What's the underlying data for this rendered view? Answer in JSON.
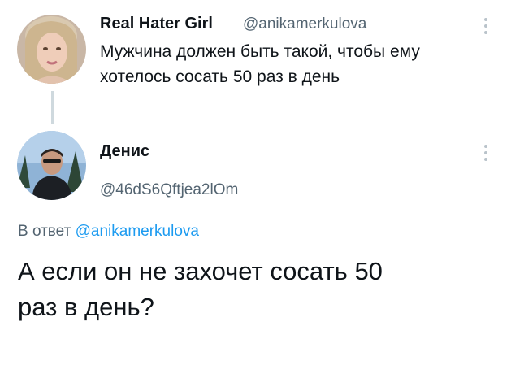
{
  "tweet1": {
    "author_name": "Real Hater Girl",
    "author_handle": "@anikamerkulova",
    "text_line1": "Мужчина должен быть такой, чтобы ему",
    "text_line2": "хотелось сосать 50 раз в день",
    "avatar_icon": "user-avatar-woman",
    "more_icon": "more-vertical-icon"
  },
  "tweet2": {
    "author_name": "Денис",
    "author_handle": "@46dS6Qftjea2lOm",
    "avatar_icon": "user-avatar-man",
    "more_icon": "more-vertical-icon"
  },
  "reply": {
    "prefix": "В ответ",
    "mention": "@anikamerkulova",
    "text_line1": "А если он не захочет сосать 50",
    "text_line2": "раз в день?"
  },
  "colors": {
    "mention": "#1d9bf0",
    "secondary_text": "#536471",
    "primary_text": "#0f1419",
    "thread_line": "#cfd9de"
  }
}
